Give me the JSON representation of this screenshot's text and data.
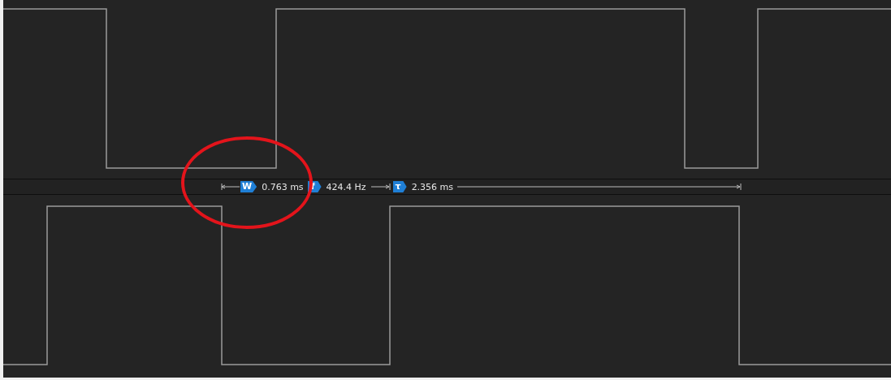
{
  "measurements": [
    {
      "kind": "width",
      "badge": "W",
      "value": "0.763 ms"
    },
    {
      "kind": "frequency",
      "badge": "f",
      "value": "424.4 Hz"
    },
    {
      "kind": "period",
      "badge": "τ",
      "value": "2.356 ms"
    }
  ],
  "annotation": {
    "kind": "circle",
    "color": "#e3141b"
  }
}
